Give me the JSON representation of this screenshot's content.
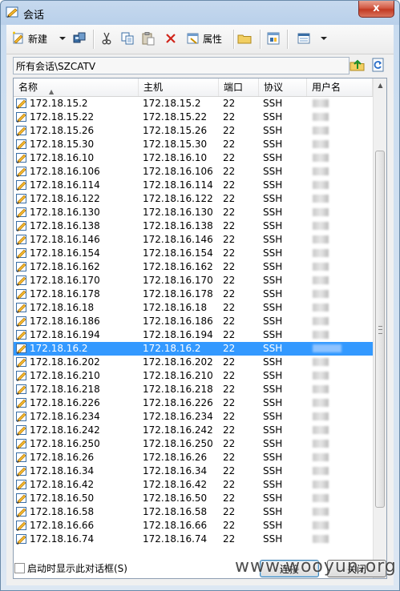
{
  "window": {
    "title": "会话",
    "close_glyph": "x"
  },
  "toolbar": {
    "new_label": "新建",
    "properties_label": "属性",
    "icons": [
      "new-session-icon",
      "dropdown-arrow-icon",
      "quick-connect-icon",
      "cut-icon",
      "copy-icon",
      "paste-icon",
      "delete-icon",
      "properties-icon",
      "folder-icon",
      "connect-in-tab-icon",
      "view-options-icon",
      "view-dropdown-icon"
    ]
  },
  "path": {
    "text": "所有会话\\SZCATV",
    "icons": [
      "folder-up-icon",
      "refresh-icon"
    ]
  },
  "columns": [
    "名称",
    "主机",
    "端口",
    "协议",
    "用户名"
  ],
  "sessions": [
    {
      "name": "172.18.15.2",
      "host": "172.18.15.2",
      "port": "22",
      "protocol": "SSH"
    },
    {
      "name": "172.18.15.22",
      "host": "172.18.15.22",
      "port": "22",
      "protocol": "SSH"
    },
    {
      "name": "172.18.15.26",
      "host": "172.18.15.26",
      "port": "22",
      "protocol": "SSH"
    },
    {
      "name": "172.18.15.30",
      "host": "172.18.15.30",
      "port": "22",
      "protocol": "SSH"
    },
    {
      "name": "172.18.16.10",
      "host": "172.18.16.10",
      "port": "22",
      "protocol": "SSH"
    },
    {
      "name": "172.18.16.106",
      "host": "172.18.16.106",
      "port": "22",
      "protocol": "SSH"
    },
    {
      "name": "172.18.16.114",
      "host": "172.18.16.114",
      "port": "22",
      "protocol": "SSH"
    },
    {
      "name": "172.18.16.122",
      "host": "172.18.16.122",
      "port": "22",
      "protocol": "SSH"
    },
    {
      "name": "172.18.16.130",
      "host": "172.18.16.130",
      "port": "22",
      "protocol": "SSH"
    },
    {
      "name": "172.18.16.138",
      "host": "172.18.16.138",
      "port": "22",
      "protocol": "SSH"
    },
    {
      "name": "172.18.16.146",
      "host": "172.18.16.146",
      "port": "22",
      "protocol": "SSH"
    },
    {
      "name": "172.18.16.154",
      "host": "172.18.16.154",
      "port": "22",
      "protocol": "SSH"
    },
    {
      "name": "172.18.16.162",
      "host": "172.18.16.162",
      "port": "22",
      "protocol": "SSH"
    },
    {
      "name": "172.18.16.170",
      "host": "172.18.16.170",
      "port": "22",
      "protocol": "SSH"
    },
    {
      "name": "172.18.16.178",
      "host": "172.18.16.178",
      "port": "22",
      "protocol": "SSH"
    },
    {
      "name": "172.18.16.18",
      "host": "172.18.16.18",
      "port": "22",
      "protocol": "SSH"
    },
    {
      "name": "172.18.16.186",
      "host": "172.18.16.186",
      "port": "22",
      "protocol": "SSH"
    },
    {
      "name": "172.18.16.194",
      "host": "172.18.16.194",
      "port": "22",
      "protocol": "SSH"
    },
    {
      "name": "172.18.16.2",
      "host": "172.18.16.2",
      "port": "22",
      "protocol": "SSH",
      "selected": true
    },
    {
      "name": "172.18.16.202",
      "host": "172.18.16.202",
      "port": "22",
      "protocol": "SSH"
    },
    {
      "name": "172.18.16.210",
      "host": "172.18.16.210",
      "port": "22",
      "protocol": "SSH"
    },
    {
      "name": "172.18.16.218",
      "host": "172.18.16.218",
      "port": "22",
      "protocol": "SSH"
    },
    {
      "name": "172.18.16.226",
      "host": "172.18.16.226",
      "port": "22",
      "protocol": "SSH"
    },
    {
      "name": "172.18.16.234",
      "host": "172.18.16.234",
      "port": "22",
      "protocol": "SSH"
    },
    {
      "name": "172.18.16.242",
      "host": "172.18.16.242",
      "port": "22",
      "protocol": "SSH"
    },
    {
      "name": "172.18.16.250",
      "host": "172.18.16.250",
      "port": "22",
      "protocol": "SSH"
    },
    {
      "name": "172.18.16.26",
      "host": "172.18.16.26",
      "port": "22",
      "protocol": "SSH"
    },
    {
      "name": "172.18.16.34",
      "host": "172.18.16.34",
      "port": "22",
      "protocol": "SSH"
    },
    {
      "name": "172.18.16.42",
      "host": "172.18.16.42",
      "port": "22",
      "protocol": "SSH"
    },
    {
      "name": "172.18.16.50",
      "host": "172.18.16.50",
      "port": "22",
      "protocol": "SSH"
    },
    {
      "name": "172.18.16.58",
      "host": "172.18.16.58",
      "port": "22",
      "protocol": "SSH"
    },
    {
      "name": "172.18.16.66",
      "host": "172.18.16.66",
      "port": "22",
      "protocol": "SSH"
    },
    {
      "name": "172.18.16.74",
      "host": "172.18.16.74",
      "port": "22",
      "protocol": "SSH"
    }
  ],
  "footer": {
    "checkbox_label": "启动时显示此对话框(S)",
    "checkbox_checked": false,
    "connect_label": "连接",
    "close_label": "关闭"
  },
  "watermark": "www.wooyun.org",
  "colors": {
    "selection": "#3399ff",
    "title_bar": "#b9d0ea",
    "close_button": "#c23a23"
  }
}
